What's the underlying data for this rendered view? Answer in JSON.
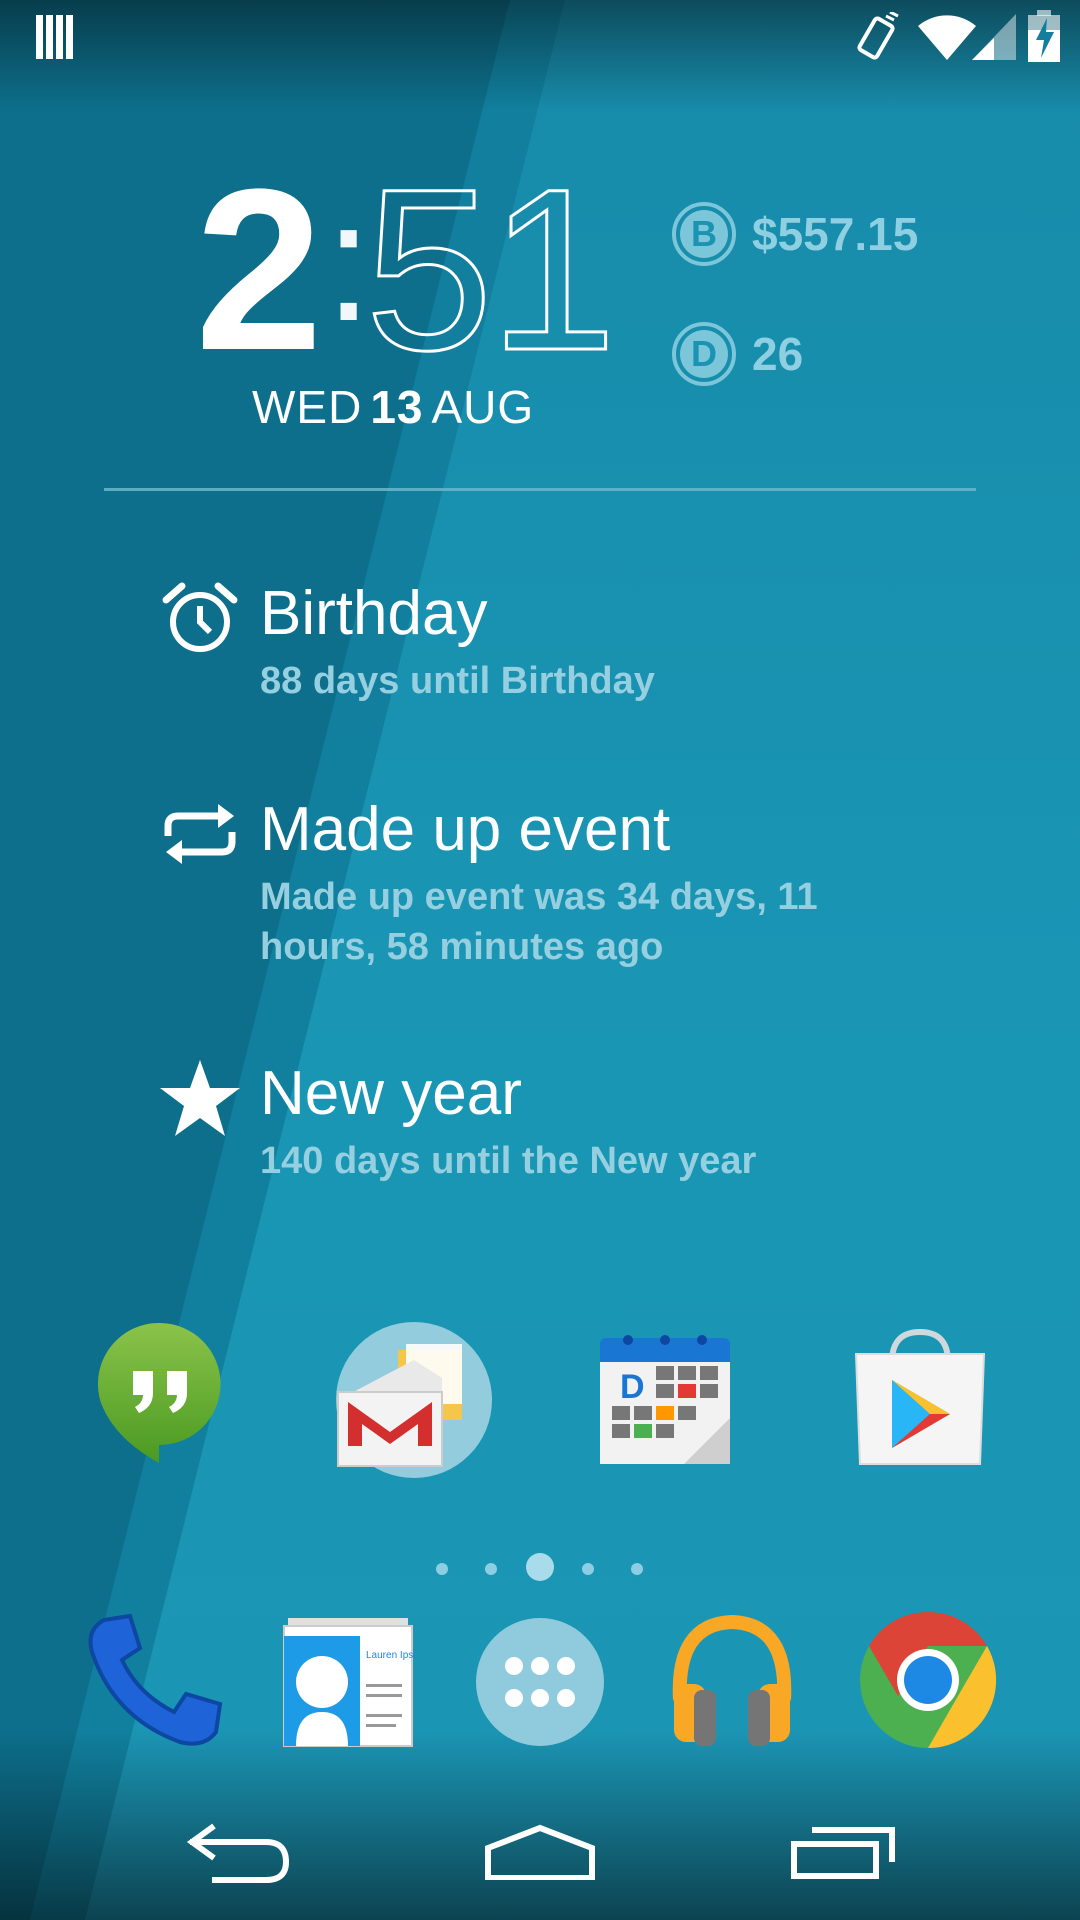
{
  "status_bar": {
    "left_icon": "barcode-notification-icon",
    "right_icons": [
      "vibrate-icon",
      "wifi-icon",
      "signal-icon",
      "battery-charging-icon"
    ]
  },
  "clock": {
    "hour": "2",
    "colon": ":",
    "minute": "51",
    "day": "WED",
    "date": "13",
    "month": "AUG"
  },
  "crypto": {
    "bitcoin": {
      "symbol": "B",
      "value": "$557.15"
    },
    "dogecoin": {
      "symbol": "D",
      "value": "26"
    }
  },
  "events": [
    {
      "icon": "alarm-clock-icon",
      "title": "Birthday",
      "subtitle": "88 days until Birthday"
    },
    {
      "icon": "repeat-icon",
      "title": "Made up event",
      "subtitle": "Made up event was 34 days, 11 hours, 58 minutes ago"
    },
    {
      "icon": "star-icon",
      "title": "New year",
      "subtitle": "140 days until the New year"
    }
  ],
  "home_apps": [
    "hangouts-icon",
    "gmail-icon",
    "calendar-icon",
    "play-store-icon"
  ],
  "page_indicator": {
    "count": 5,
    "active": 3
  },
  "dock_apps": [
    "phone-icon",
    "contacts-icon",
    "app-drawer-icon",
    "play-music-icon",
    "chrome-icon"
  ],
  "contacts_card": {
    "name": "Lauren Ipsum"
  },
  "calendar_icon_letter": "D",
  "colors": {
    "background": "#1b93b2",
    "dark_stripe": "#0d6f8b",
    "subtitle": "#96cfe0",
    "crypto": "#8ed0e2"
  }
}
